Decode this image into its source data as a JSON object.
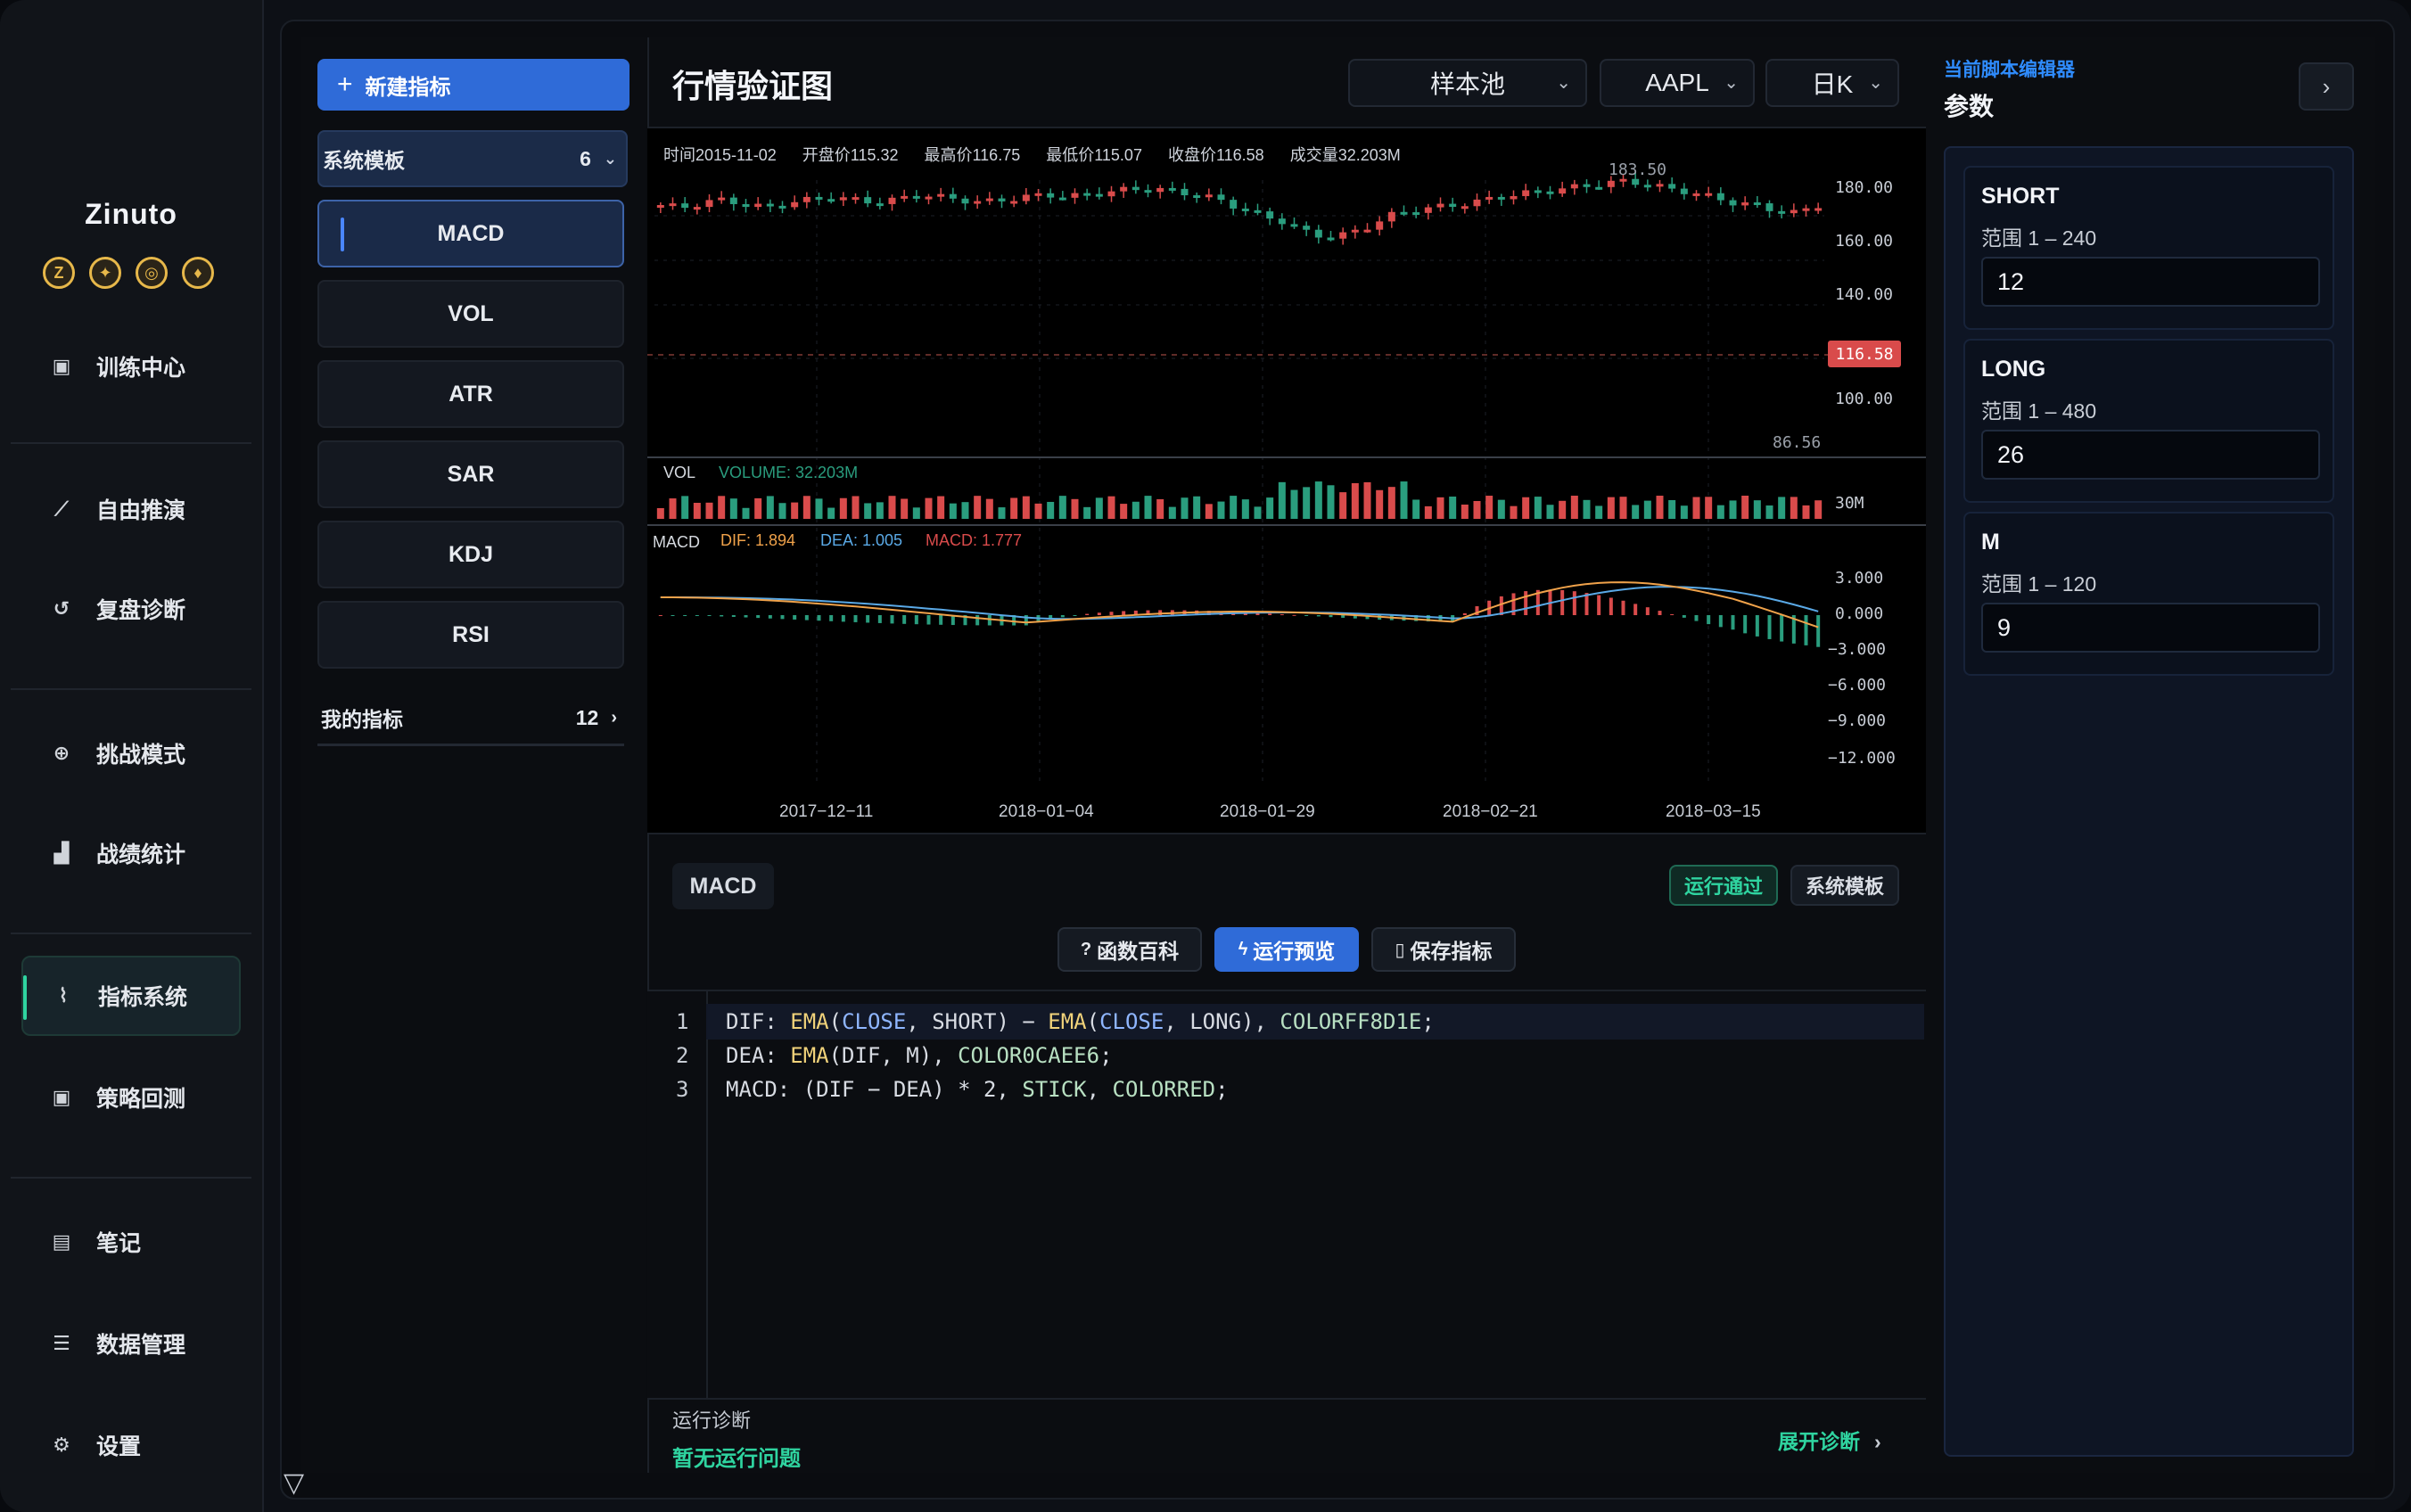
{
  "app": {
    "name": "Zinuto"
  },
  "nav": [
    {
      "label": "训练中心",
      "icon": "training-icon"
    },
    {
      "label": "自由推演",
      "icon": "trend-icon"
    },
    {
      "label": "复盘诊断",
      "icon": "history-icon"
    },
    {
      "label": "挑战模式",
      "icon": "target-icon"
    },
    {
      "label": "战绩统计",
      "icon": "stats-icon"
    },
    {
      "label": "指标系统",
      "icon": "indicator-icon"
    },
    {
      "label": "策略回测",
      "icon": "backtest-icon"
    },
    {
      "label": "笔记",
      "icon": "note-icon"
    },
    {
      "label": "数据管理",
      "icon": "database-icon"
    },
    {
      "label": "设置",
      "icon": "gear-icon"
    }
  ],
  "indicators": {
    "new_label": "新建指标",
    "template_label": "系统模板",
    "template_count": "6",
    "items": [
      "MACD",
      "VOL",
      "ATR",
      "SAR",
      "KDJ",
      "RSI"
    ],
    "mine_label": "我的指标",
    "mine_count": "12"
  },
  "center": {
    "title": "行情验证图",
    "pool": "样本池",
    "symbol": "AAPL",
    "period": "日K"
  },
  "chart_info": {
    "time": "时间2015-11-02",
    "open": "开盘价115.32",
    "high": "最高价116.75",
    "low": "最低价115.07",
    "close": "收盘价116.58",
    "volume": "成交量32.203M"
  },
  "vol_pane": {
    "name": "VOL",
    "legend": "VOLUME: 32.203M",
    "axis": "30M"
  },
  "macd_pane": {
    "name": "MACD",
    "dif": "DIF: 1.894",
    "dea": "DEA: 1.005",
    "macd": "MACD: 1.777"
  },
  "price_axis": [
    "180.00",
    "160.00",
    "140.00",
    "116.58",
    "100.00"
  ],
  "price_marks": {
    "high": "183.50",
    "low": "86.56",
    "last": "116.58"
  },
  "macd_axis": [
    "3.000",
    "0.000",
    "−3.000",
    "−6.000",
    "−9.000",
    "−12.000"
  ],
  "dates": [
    "2017−12−11",
    "2018−01−04",
    "2018−01−29",
    "2018−02−21",
    "2018−03−15"
  ],
  "chart_data": {
    "type": "candlestick",
    "x_ticks": [
      "2017-12-11",
      "2018-01-04",
      "2018-01-29",
      "2018-02-21",
      "2018-03-15"
    ],
    "price_ylim": [
      86.56,
      190
    ],
    "macd_ylim": [
      -12,
      4
    ],
    "close_approx": [
      174,
      173,
      175,
      176,
      174,
      173,
      175,
      176,
      177,
      176,
      175,
      176,
      178,
      177,
      176,
      175,
      176,
      177,
      178,
      177,
      178,
      179,
      180,
      180,
      179,
      178,
      176,
      173,
      170,
      168,
      164,
      162,
      163,
      166,
      170,
      172,
      173,
      174,
      175,
      177,
      178,
      179,
      180,
      181,
      182,
      183,
      182,
      180,
      179,
      177,
      175,
      174,
      172,
      171,
      174
    ],
    "series": [
      {
        "name": "DIF",
        "color": "#f0a24a"
      },
      {
        "name": "DEA",
        "color": "#5aa9e6"
      },
      {
        "name": "MACD",
        "color": "#d94b4b"
      }
    ]
  },
  "editor": {
    "name": "MACD",
    "status": "运行通过",
    "source": "系统模板",
    "btn_help": "函数百科",
    "btn_run": "运行预览",
    "btn_save": "保存指标",
    "lines": [
      "DIF: EMA(CLOSE, SHORT) − EMA(CLOSE, LONG), COLORFF8D1E;",
      "DEA: EMA(DIF, M), COLOR0CAEE6;",
      "MACD: (DIF − DEA) * 2, STICK, COLORRED;"
    ],
    "line_numbers": [
      "1",
      "2",
      "3"
    ]
  },
  "diagnosis": {
    "title": "运行诊断",
    "value": "暂无运行问题",
    "expand": "展开诊断"
  },
  "right": {
    "subtitle": "当前脚本编辑器",
    "title": "参数",
    "params": [
      {
        "name": "SHORT",
        "range": "范围 1 – 240",
        "value": "12"
      },
      {
        "name": "LONG",
        "range": "范围 1 – 480",
        "value": "26"
      },
      {
        "name": "M",
        "range": "范围 1 – 120",
        "value": "9"
      }
    ]
  },
  "colors": {
    "accent": "#2f6bd8",
    "green": "#2fd4a0",
    "up": "#d94b4b",
    "down": "#2a9d7e"
  }
}
